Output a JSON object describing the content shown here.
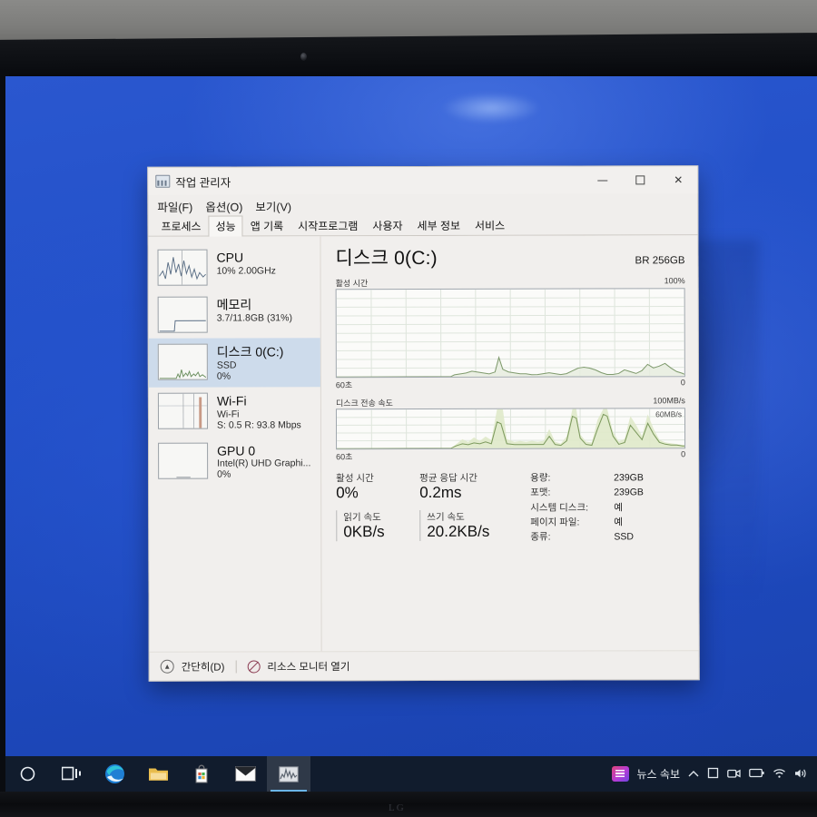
{
  "window": {
    "title": "작업 관리자",
    "icon": "task-manager-icon",
    "minimize": "−",
    "maximize": "□",
    "close": "✕"
  },
  "menu": [
    "파일(F)",
    "옵션(O)",
    "보기(V)"
  ],
  "tabs": [
    {
      "label": "프로세스",
      "active": false
    },
    {
      "label": "성능",
      "active": true
    },
    {
      "label": "앱 기록",
      "active": false
    },
    {
      "label": "시작프로그램",
      "active": false
    },
    {
      "label": "사용자",
      "active": false
    },
    {
      "label": "세부 정보",
      "active": false
    },
    {
      "label": "서비스",
      "active": false
    }
  ],
  "sidebar": {
    "items": [
      {
        "name": "CPU",
        "sub1": "10% 2.00GHz",
        "sub2": "",
        "selected": false
      },
      {
        "name": "메모리",
        "sub1": "3.7/11.8GB (31%)",
        "sub2": "",
        "selected": false
      },
      {
        "name": "디스크 0(C:)",
        "sub1": "SSD",
        "sub2": "0%",
        "selected": true
      },
      {
        "name": "Wi-Fi",
        "sub1": "Wi-Fi",
        "sub2": "S: 0.5 R: 93.8 Mbps",
        "selected": false
      },
      {
        "name": "GPU 0",
        "sub1": "Intel(R) UHD Graphi...",
        "sub2": "0%",
        "selected": false
      }
    ]
  },
  "main": {
    "title": "디스크 0(C:)",
    "model": "BR 256GB",
    "graph1": {
      "label": "활성 시간",
      "max": "100%",
      "min": "0",
      "span": "60초"
    },
    "graph2": {
      "label": "디스크 전송 속도",
      "max": "100MB/s",
      "min": "0",
      "span": "60초",
      "inline": "60MB/s"
    },
    "stats_left": [
      {
        "label": "활성 시간",
        "value": "0%"
      },
      {
        "label": "평균 응답 시간",
        "value": "0.2ms"
      },
      {
        "label": "읽기 속도",
        "value": "0KB/s"
      },
      {
        "label": "쓰기 속도",
        "value": "20.2KB/s"
      }
    ],
    "stats_right": [
      {
        "key": "용량:",
        "value": "239GB"
      },
      {
        "key": "포맷:",
        "value": "239GB"
      },
      {
        "key": "시스템 디스크:",
        "value": "예"
      },
      {
        "key": "페이지 파일:",
        "value": "예"
      },
      {
        "key": "종류:",
        "value": "SSD"
      }
    ]
  },
  "footer": {
    "collapse": "간단히(D)",
    "resource_monitor": "리소스 모니터 열기"
  },
  "taskbar": {
    "buttons": [
      {
        "name": "search-icon"
      },
      {
        "name": "task-view-icon"
      },
      {
        "name": "edge-icon"
      },
      {
        "name": "file-explorer-icon"
      },
      {
        "name": "microsoft-store-icon"
      },
      {
        "name": "mail-icon"
      },
      {
        "name": "task-manager-icon"
      }
    ],
    "news_label": "뉴스 속보",
    "tray": [
      "∧",
      "▯",
      "▭",
      "▭",
      "📶",
      "🔊"
    ]
  },
  "chart_data": [
    {
      "type": "area",
      "title": "활성 시간",
      "ylabel": "",
      "xlabel": "60초",
      "ylim": [
        0,
        100
      ],
      "ytick_labels": [
        "100%",
        "0"
      ],
      "grid": true,
      "color": "#6b8f5e",
      "values": [
        0,
        0,
        0,
        0,
        0,
        0,
        0,
        0,
        0,
        0,
        0,
        0,
        0,
        0,
        0,
        0,
        0,
        0,
        0,
        0,
        0,
        0,
        0,
        0,
        2,
        3,
        4,
        6,
        5,
        4,
        3,
        5,
        22,
        14,
        8,
        6,
        5,
        4,
        4,
        3,
        3,
        4,
        6,
        5,
        4,
        3,
        3,
        4,
        5,
        4,
        3,
        3,
        6,
        9,
        10,
        9,
        7,
        4,
        2,
        2,
        3,
        7,
        5,
        3,
        6,
        13,
        9,
        11,
        14,
        9,
        5,
        3,
        2,
        2
      ]
    },
    {
      "type": "area",
      "title": "디스크 전송 속도",
      "ylabel": "",
      "xlabel": "60초",
      "ylim": [
        0,
        100
      ],
      "ytick_labels": [
        "100MB/s",
        "0"
      ],
      "annotations": [
        "60MB/s"
      ],
      "grid": true,
      "series": [
        {
          "name": "전송 속도(채움)",
          "color": "#c4d7a0",
          "values": [
            0,
            0,
            0,
            0,
            0,
            0,
            0,
            0,
            0,
            0,
            0,
            0,
            0,
            0,
            0,
            0,
            0,
            0,
            0,
            0,
            0,
            0,
            0,
            0,
            10,
            18,
            14,
            20,
            16,
            22,
            18,
            14,
            92,
            40,
            12,
            10,
            8,
            9,
            10,
            8,
            7,
            9,
            12,
            10,
            8,
            7,
            9,
            10,
            55,
            20,
            12,
            30,
            90,
            35,
            18,
            12,
            10,
            9,
            70,
            95,
            40,
            15,
            12,
            20,
            75,
            60,
            30,
            70,
            45,
            20,
            12,
            8,
            6,
            5
          ]
        },
        {
          "name": "전송 속도(선)",
          "color": "#7d9a5e",
          "values": [
            0,
            0,
            0,
            0,
            0,
            0,
            0,
            0,
            0,
            0,
            0,
            0,
            0,
            0,
            0,
            0,
            0,
            0,
            0,
            0,
            0,
            0,
            0,
            0,
            4,
            6,
            5,
            7,
            6,
            8,
            7,
            6,
            35,
            18,
            6,
            5,
            4,
            5,
            6,
            5,
            4,
            6,
            8,
            6,
            5,
            4,
            6,
            7,
            30,
            12,
            8,
            20,
            60,
            22,
            10,
            8,
            7,
            6,
            48,
            70,
            28,
            10,
            8,
            14,
            52,
            42,
            20,
            48,
            30,
            14,
            8,
            5,
            4,
            3
          ]
        }
      ]
    }
  ]
}
